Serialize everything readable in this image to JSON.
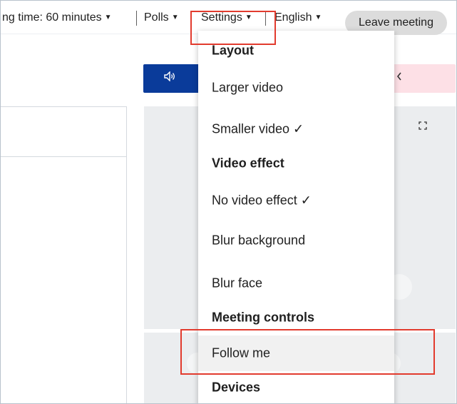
{
  "topbar": {
    "meeting_time": "ng time: 60 minutes",
    "polls": "Polls",
    "settings": "Settings",
    "language": "English",
    "caret": "▼",
    "leave_button": "Leave meeting"
  },
  "content": {
    "audio_icon": "speaker-icon",
    "pink_icon": "chevron-left-icon",
    "expand_icon": "fullscreen-icon"
  },
  "settings_menu": {
    "layout_heading": "Layout",
    "larger_video": "Larger video",
    "smaller_video": "Smaller video ✓",
    "video_effect_heading": "Video effect",
    "no_video_effect": "No video effect ✓",
    "blur_background": "Blur background",
    "blur_face": "Blur face",
    "meeting_controls_heading": "Meeting controls",
    "follow_me": "Follow me",
    "devices_heading": "Devices"
  },
  "colors": {
    "accent_blue": "#0a3b9a",
    "highlight_red": "#e23b2e",
    "pink": "#fde0e6"
  }
}
